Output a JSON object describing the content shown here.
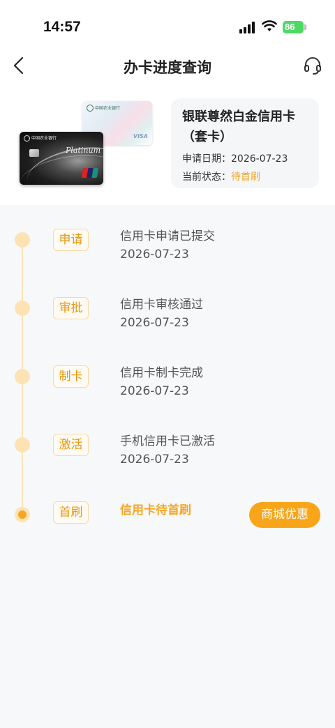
{
  "status_bar": {
    "time": "14:57",
    "battery": "86",
    "icons": [
      "signal-icon",
      "wifi-icon",
      "battery-icon"
    ]
  },
  "nav": {
    "title": "办卡进度查询",
    "back_icon": "chevron-left-icon",
    "support_icon": "headset-icon"
  },
  "card_info": {
    "name": "银联尊然白金信用卡（套卡）",
    "apply_date_label": "申请日期：",
    "apply_date": "2026-07-23",
    "status_label": "当前状态：",
    "status": "待首刷",
    "card_image_text": {
      "bank": "中国农业银行",
      "tier": "Platinum"
    }
  },
  "colors": {
    "accent": "#f5a623",
    "button": "#f9a51a",
    "timeline": "#fde3b3"
  },
  "timeline": [
    {
      "tag": "申请",
      "text": "信用卡申请已提交",
      "date": "2026-07-23",
      "current": false
    },
    {
      "tag": "审批",
      "text": "信用卡审核通过",
      "date": "2026-07-23",
      "current": false
    },
    {
      "tag": "制卡",
      "text": "信用卡制卡完成",
      "date": "2026-07-23",
      "current": false
    },
    {
      "tag": "激活",
      "text": "手机信用卡已激活",
      "date": "2026-07-23",
      "current": false
    },
    {
      "tag": "首刷",
      "text": "信用卡待首刷",
      "date": "",
      "current": true
    }
  ],
  "mall_button": "商城优惠"
}
